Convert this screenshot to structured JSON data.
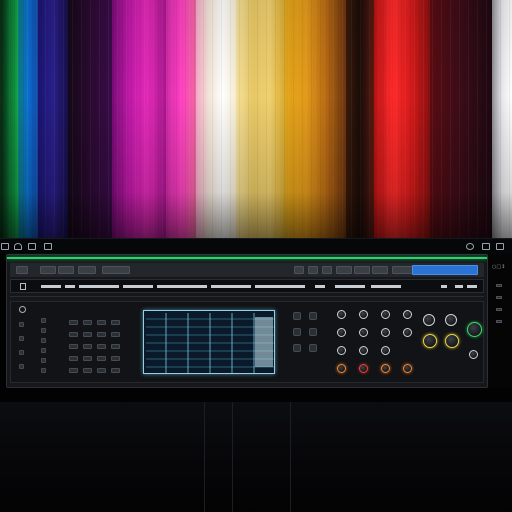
{
  "background": {
    "description_colors": [
      "#0a3a18",
      "#12a84a",
      "#0c6fd0",
      "#2a1f8a",
      "#3a0c4a",
      "#c21aa8",
      "#ff3fc2",
      "#f06aa0",
      "#f3e6d8",
      "#e8c864",
      "#e39a1a",
      "#a8581a",
      "#d61a1a",
      "#ff2a2a",
      "#7a1010",
      "#3a0c18",
      "#e8e8ec"
    ]
  },
  "colors": {
    "accent_green": "#2bd46a",
    "accent_blue": "#2a72d4",
    "screen_outline": "#8fd2e6",
    "panel_bg": "#15171b"
  },
  "menubar": {
    "icons": [
      "window-icon",
      "home-icon",
      "square-icon",
      "grid-icon"
    ],
    "right_icons": [
      "settings-icon",
      "window-icon",
      "maximize-icon"
    ]
  },
  "rightside": {
    "label": "○□↕"
  },
  "device": {
    "row1_chips": [
      "screen-icon",
      "note-icon",
      "play-icon",
      "stop-icon",
      "record-icon"
    ],
    "row2_text": "▬▬ ▬ ▬▬▬▬▬ ▬▬▬▬▬▬▬",
    "screen": {
      "rows": 8,
      "cols": 6
    },
    "knobs": [
      {
        "color": "w"
      },
      {
        "color": "w"
      },
      {
        "color": "w"
      },
      {
        "color": "w"
      },
      {
        "color": "y"
      },
      {
        "color": "y"
      },
      {
        "color": "g"
      },
      {
        "color": "o"
      },
      {
        "color": "r"
      },
      {
        "color": "o"
      }
    ]
  }
}
